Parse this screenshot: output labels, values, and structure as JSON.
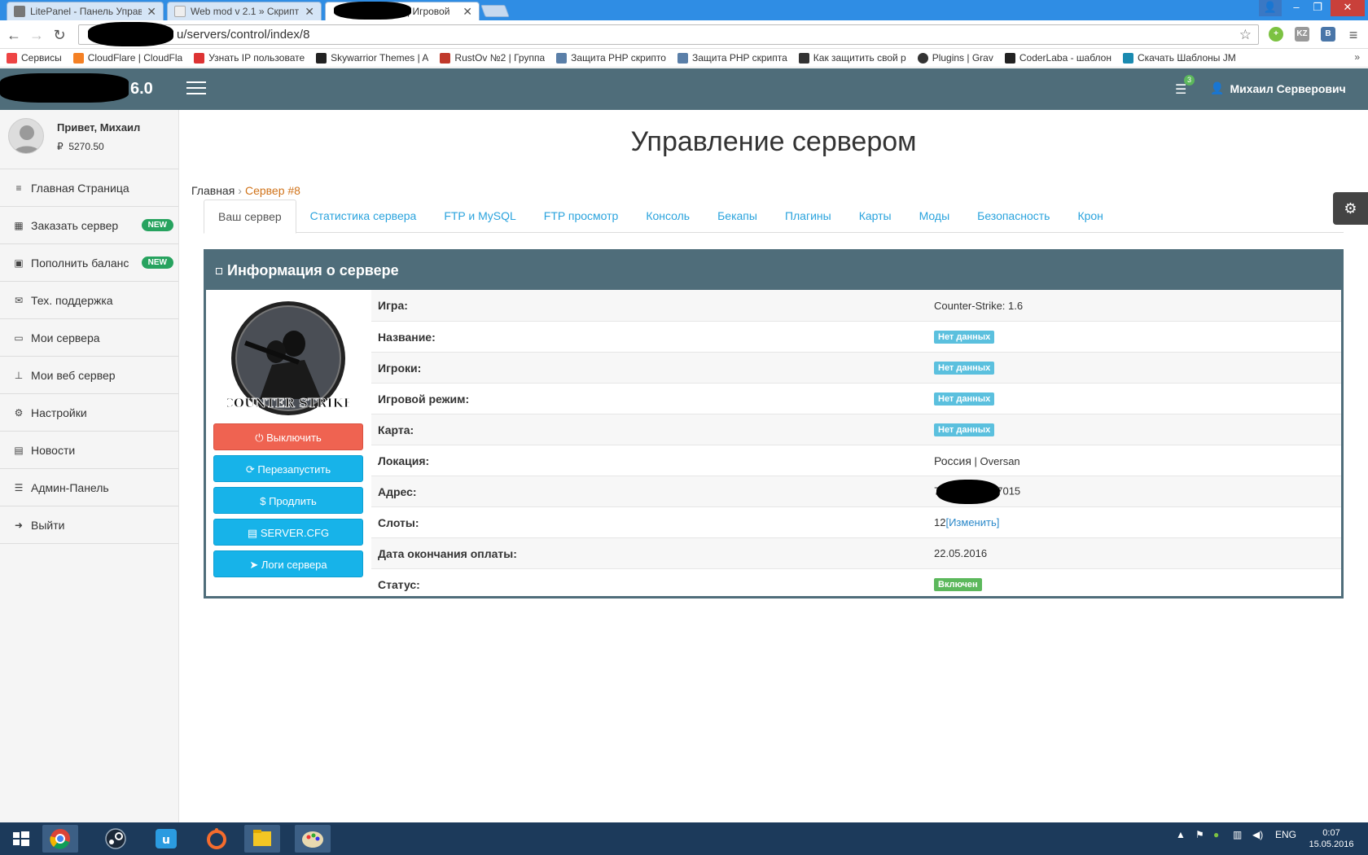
{
  "browser": {
    "tabs": [
      {
        "title": "LitePanel - Панель Управ"
      },
      {
        "title": "Web mod v 2.1 » Скрипт"
      },
      {
        "title": "| Игровой"
      }
    ],
    "url": "u/servers/control/index/8",
    "bookmarks": [
      {
        "label": "Сервисы",
        "color": "#e44"
      },
      {
        "label": "CloudFlare | CloudFla",
        "color": "#f48024"
      },
      {
        "label": "Узнать IP пользовате",
        "color": "#d33"
      },
      {
        "label": "Skywarrior Themes | A",
        "color": "#222"
      },
      {
        "label": "RustOv №2 | Группа",
        "color": "#c0392b"
      },
      {
        "label": "Защита PHP скрипто",
        "color": "#5a7fa8"
      },
      {
        "label": "Защита PHP скрипта",
        "color": "#5a7fa8"
      },
      {
        "label": "Как защитить свой р",
        "color": "#333"
      },
      {
        "label": "Plugins | Grav",
        "color": "#333"
      },
      {
        "label": "CoderLaba - шаблон",
        "color": "#222"
      },
      {
        "label": "Скачать Шаблоны JM",
        "color": "#1a8ab0"
      }
    ],
    "bookmarks_more": "»",
    "ext_labels": [
      "KZ",
      "B"
    ]
  },
  "header": {
    "brand_suffix": "6.0",
    "notif_count": "3",
    "user_name": "Михаил Серверович"
  },
  "sidebar": {
    "greeting": "Привет, Михаил",
    "balance_currency": "₽",
    "balance": "5270.50",
    "items": [
      {
        "label": "Главная Страница",
        "icon": "≡",
        "badge": ""
      },
      {
        "label": "Заказать сервер",
        "icon": "▦",
        "badge": "NEW"
      },
      {
        "label": "Пополнить баланс",
        "icon": "▣",
        "badge": "NEW"
      },
      {
        "label": "Тех. поддержка",
        "icon": "✉",
        "badge": ""
      },
      {
        "label": "Мои сервера",
        "icon": "▭",
        "badge": ""
      },
      {
        "label": "Мои веб сервер",
        "icon": "⊥",
        "badge": ""
      },
      {
        "label": "Настройки",
        "icon": "⚙",
        "badge": ""
      },
      {
        "label": "Новости",
        "icon": "▤",
        "badge": ""
      },
      {
        "label": "Админ-Панель",
        "icon": "☰",
        "badge": ""
      },
      {
        "label": "Выйти",
        "icon": "➜",
        "badge": ""
      }
    ]
  },
  "main": {
    "title": "Управление сервером",
    "breadcrumb": {
      "home": "Главная",
      "sep": "›",
      "current": "Сервер #8"
    },
    "tabs": [
      "Ваш сервер",
      "Статистика сервера",
      "FTP и MySQL",
      "FTP просмотр",
      "Консоль",
      "Бекапы",
      "Плагины",
      "Карты",
      "Моды",
      "Безопасность",
      "Крон"
    ],
    "panel_title": "Информация о сервере",
    "logo_text": "COUNTER STRIKE",
    "buttons": [
      {
        "label": "Выключить",
        "icon": "⏻"
      },
      {
        "label": "Перезапустить",
        "icon": "⟳"
      },
      {
        "label": "Продлить",
        "icon": "$"
      },
      {
        "label": "SERVER.CFG",
        "icon": "▤"
      },
      {
        "label": "Логи сервера",
        "icon": "➤"
      }
    ],
    "info": {
      "game_label": "Игра:",
      "game_value": "Counter-Strike: 1.6",
      "name_label": "Название:",
      "name_value": "Нет данных",
      "players_label": "Игроки:",
      "players_value": "Нет данных",
      "mode_label": "Игровой режим:",
      "mode_value": "Нет данных",
      "map_label": "Карта:",
      "map_value": "Нет данных",
      "location_label": "Локация:",
      "location_country": "Россия",
      "location_sep": " | ",
      "location_dc": "Oversan",
      "address_label": "Адрес:",
      "address_prefix": "7",
      "address_suffix": "7015",
      "slots_label": "Слоты:",
      "slots_value": "12",
      "slots_change": "[Изменить]",
      "paid_label": "Дата окончания оплаты:",
      "paid_value": "22.05.2016",
      "status_label": "Статус:",
      "status_value": "Включен"
    }
  },
  "taskbar": {
    "lang": "ENG",
    "time": "0:07",
    "date": "15.05.2016"
  },
  "colors": {
    "header": "#4f6d7a",
    "btn_red": "#ef6351",
    "btn_blue": "#17b3e9",
    "badge_new": "#27a35f",
    "label_info": "#5bc0de",
    "label_success": "#5cb85c"
  }
}
